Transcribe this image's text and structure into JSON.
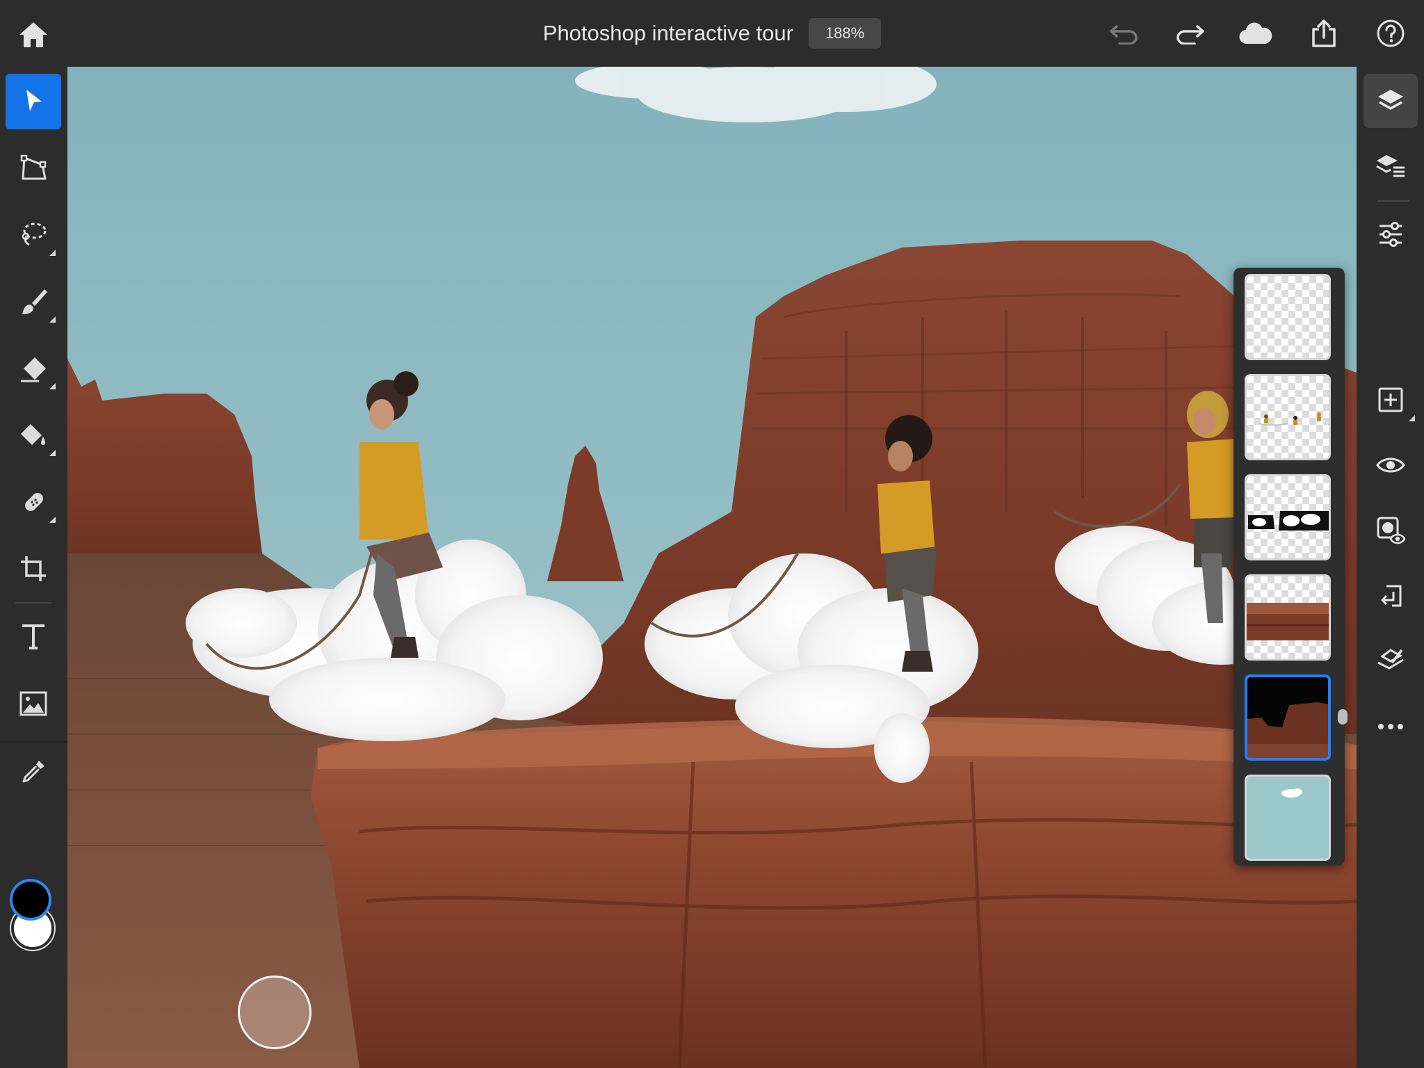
{
  "header": {
    "title": "Photoshop interactive tour",
    "zoom": "188%",
    "icons": [
      "home-icon",
      "undo-icon",
      "redo-icon",
      "cloud-icon",
      "share-icon",
      "help-icon"
    ]
  },
  "left_toolbar": {
    "tools": [
      "select",
      "transform",
      "lasso",
      "brush",
      "eraser",
      "fill",
      "healing",
      "crop",
      "type",
      "place-image",
      "eyedropper"
    ],
    "active_tool": "select",
    "foreground_color": "#000000",
    "background_color": "#ffffff",
    "accent": "#1473e6"
  },
  "right_toolbar": {
    "buttons": [
      "layers",
      "layer-details",
      "adjustments",
      "add-layer",
      "visibility",
      "mask",
      "import",
      "clear-selection",
      "more"
    ],
    "active": "layers"
  },
  "layers": {
    "count": 6,
    "selected_index": 4,
    "thumbnails": [
      "empty-transparent",
      "children-cutouts",
      "cloud-mask",
      "rock-cliff",
      "mesa-silhouette",
      "sky-background"
    ]
  }
}
